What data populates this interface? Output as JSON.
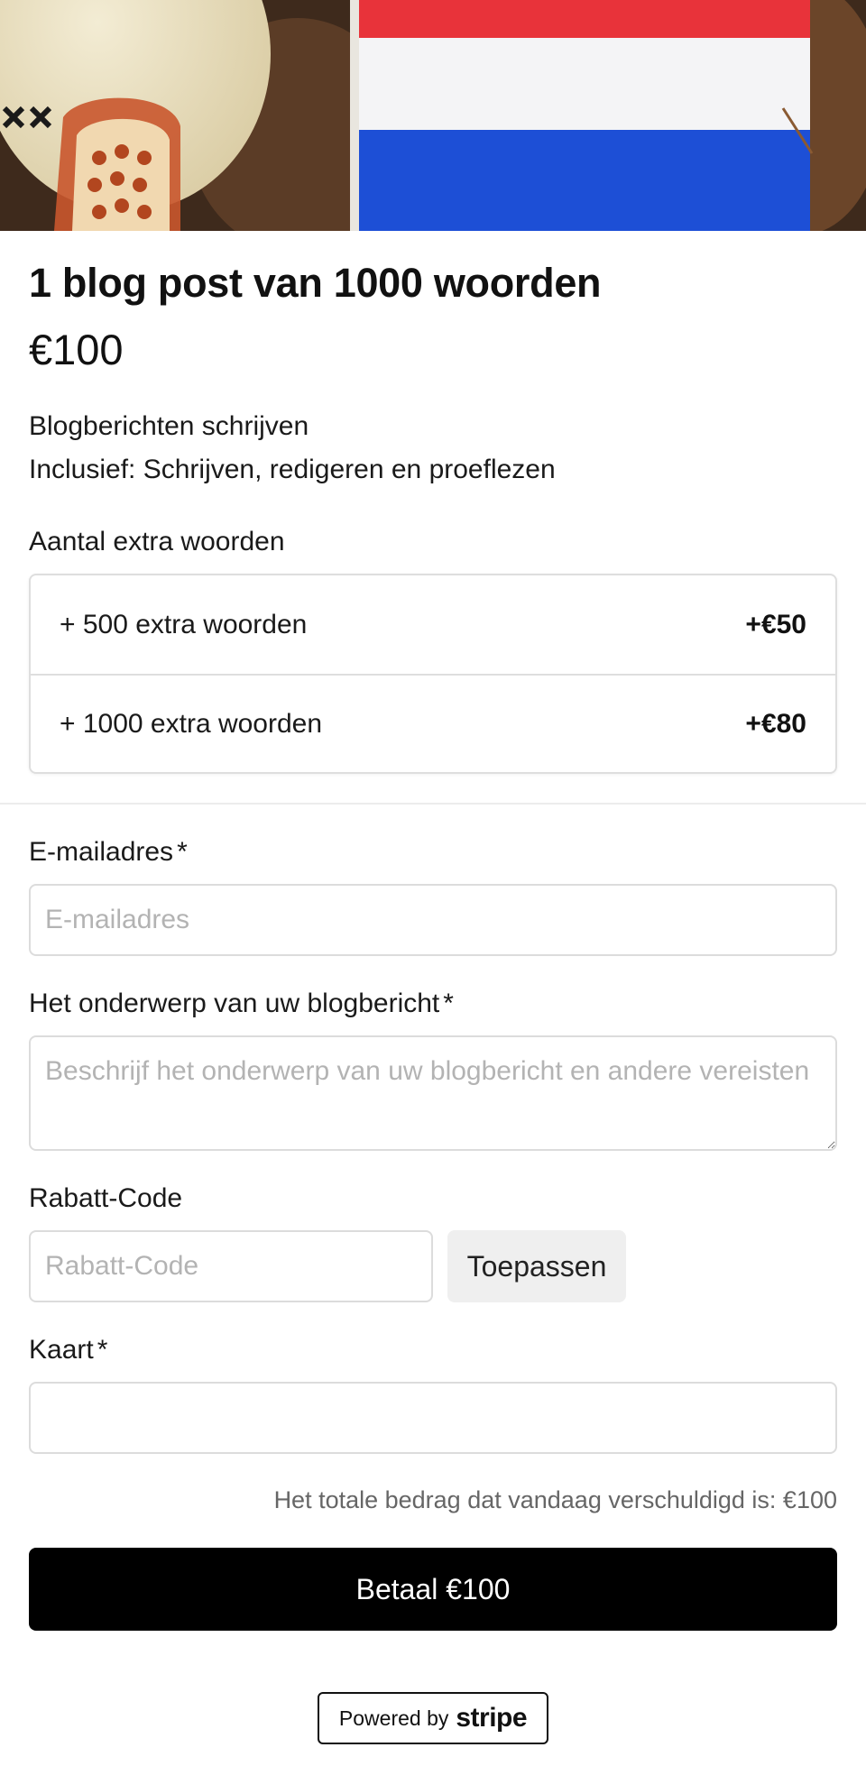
{
  "product": {
    "title": "1 blog post van 1000 woorden",
    "price": "€100",
    "description_line1": "Blogberichten schrijven",
    "description_line2": "Inclusief: Schrijven, redigeren en proeflezen"
  },
  "extras": {
    "label": "Aantal extra woorden",
    "options": [
      {
        "label": "+ 500 extra woorden",
        "price": "+€50"
      },
      {
        "label": "+ 1000 extra woorden",
        "price": "+€80"
      }
    ]
  },
  "form": {
    "email": {
      "label": "E-mailadres",
      "required_mark": "*",
      "value": "",
      "placeholder": "E-mailadres"
    },
    "topic": {
      "label": "Het onderwerp van uw blogbericht",
      "required_mark": "*",
      "value": "",
      "placeholder": "Beschrijf het onderwerp van uw blogbericht en andere vereisten"
    },
    "coupon": {
      "label": "Rabatt-Code",
      "value": "",
      "placeholder": "Rabatt-Code",
      "apply_label": "Toepassen"
    },
    "card": {
      "label": "Kaart",
      "required_mark": "*",
      "value": ""
    }
  },
  "total_text": "Het totale bedrag dat vandaag verschuldigd is: €100",
  "pay_button": "Betaal €100",
  "footer": {
    "powered_text": "Powered by",
    "brand": "stripe"
  },
  "hero": {
    "flag_colors": [
      "#e8333a",
      "#f4f4f6",
      "#1d4fd6"
    ],
    "background": "#4a3222"
  }
}
